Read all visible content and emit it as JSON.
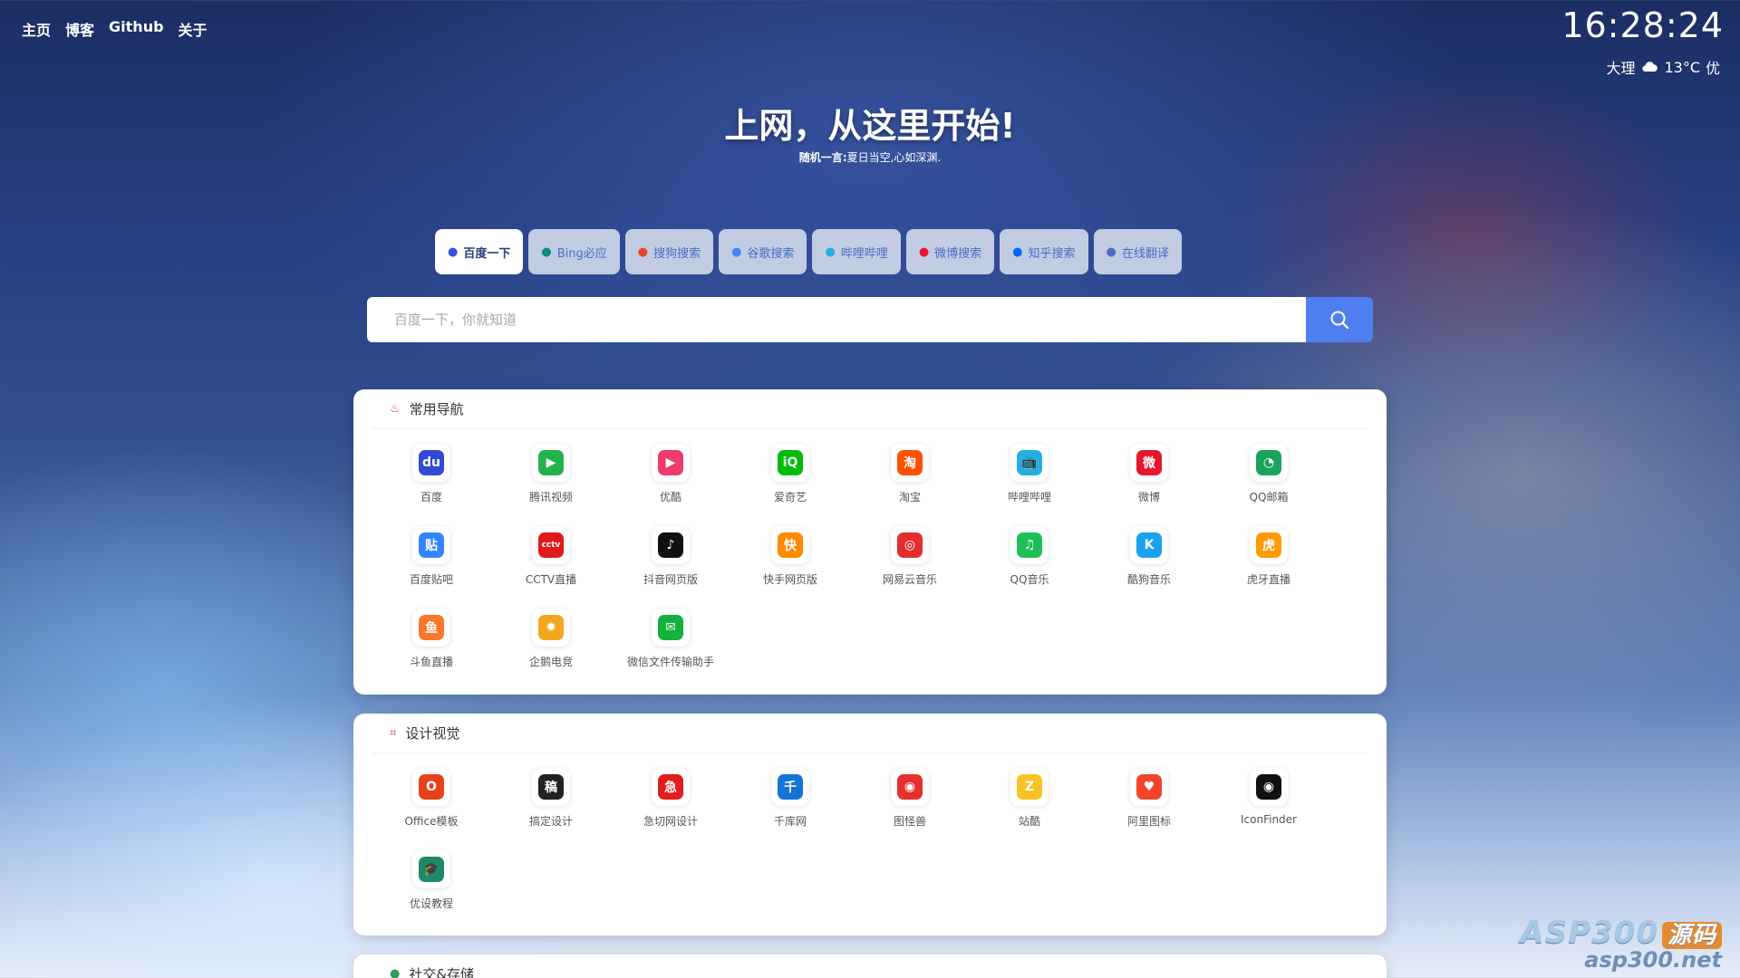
{
  "topnav": [
    "主页",
    "博客",
    "Github",
    "关于"
  ],
  "clock": "16:28:24",
  "weather": {
    "city": "大理",
    "icon": "cloud-icon",
    "temp": "13°C",
    "aqi": "优"
  },
  "hero": {
    "title": "上网，从这里开始!",
    "quote_prefix": "随机一言:",
    "quote": "夏日当空,心如深渊."
  },
  "engines": [
    {
      "label": "百度一下",
      "icon": "baidu-icon",
      "color": "#3452d6",
      "active": true
    },
    {
      "label": "Bing必应",
      "icon": "bing-icon",
      "color": "#0c8a7a",
      "active": false
    },
    {
      "label": "搜狗搜索",
      "icon": "sogou-icon",
      "color": "#e2452f",
      "active": false
    },
    {
      "label": "谷歌搜索",
      "icon": "google-icon",
      "color": "#4285f4",
      "active": false
    },
    {
      "label": "哔哩哔哩",
      "icon": "bilibili-icon",
      "color": "#23ade5",
      "active": false
    },
    {
      "label": "微博搜索",
      "icon": "weibo-icon",
      "color": "#e6162d",
      "active": false
    },
    {
      "label": "知乎搜索",
      "icon": "zhihu-icon",
      "color": "#0066ff",
      "active": false
    },
    {
      "label": "在线翻译",
      "icon": "translate-icon",
      "color": "#4a6cc8",
      "active": false
    }
  ],
  "search": {
    "placeholder": "百度一下，你就知道"
  },
  "sections": [
    {
      "title": "常用导航",
      "icon": "fire-icon",
      "icon_color": "#e23d3d",
      "items": [
        {
          "label": "百度",
          "glyph": "du",
          "color": "#2f4bd6",
          "icon": "baidu-icon"
        },
        {
          "label": "腾讯视频",
          "glyph": "▶",
          "color": "#22b24c",
          "icon": "tencent-video-icon"
        },
        {
          "label": "优酷",
          "glyph": "▶",
          "color": "#ef3b6a",
          "icon": "youku-icon"
        },
        {
          "label": "爱奇艺",
          "glyph": "iQ",
          "color": "#00be06",
          "icon": "iqiyi-icon"
        },
        {
          "label": "淘宝",
          "glyph": "淘",
          "color": "#ff5000",
          "icon": "taobao-icon"
        },
        {
          "label": "哔哩哔哩",
          "glyph": "📺",
          "color": "#23ade5",
          "icon": "bilibili-icon"
        },
        {
          "label": "微博",
          "glyph": "微",
          "color": "#e6162d",
          "icon": "weibo-icon"
        },
        {
          "label": "QQ邮箱",
          "glyph": "◔",
          "color": "#1aa35b",
          "icon": "qq-mail-icon"
        },
        {
          "label": "百度贴吧",
          "glyph": "贴",
          "color": "#3385ff",
          "icon": "tieba-icon"
        },
        {
          "label": "CCTV直播",
          "glyph": "cctv",
          "color": "#e01a1a",
          "icon": "cctv-icon"
        },
        {
          "label": "抖音网页版",
          "glyph": "♪",
          "color": "#111111",
          "icon": "douyin-icon"
        },
        {
          "label": "快手网页版",
          "glyph": "快",
          "color": "#ff8a00",
          "icon": "kuaishou-icon"
        },
        {
          "label": "网易云音乐",
          "glyph": "◎",
          "color": "#e12f2f",
          "icon": "netease-music-icon"
        },
        {
          "label": "QQ音乐",
          "glyph": "♫",
          "color": "#1fbf57",
          "icon": "qq-music-icon"
        },
        {
          "label": "酷狗音乐",
          "glyph": "K",
          "color": "#1aa2ed",
          "icon": "kugou-icon"
        },
        {
          "label": "虎牙直播",
          "glyph": "虎",
          "color": "#ff9a00",
          "icon": "huya-icon"
        },
        {
          "label": "斗鱼直播",
          "glyph": "鱼",
          "color": "#f8772c",
          "icon": "douyu-icon"
        },
        {
          "label": "企鹅电竞",
          "glyph": "✹",
          "color": "#f3a81c",
          "icon": "penguin-esports-icon"
        },
        {
          "label": "微信文件传输助手",
          "glyph": "✉",
          "color": "#15b13d",
          "icon": "wechat-icon"
        }
      ]
    },
    {
      "title": "设计视觉",
      "icon": "crop-icon",
      "icon_color": "#d63a8c",
      "items": [
        {
          "label": "Office模板",
          "glyph": "O",
          "color": "#e6421a",
          "icon": "office-icon"
        },
        {
          "label": "搞定设计",
          "glyph": "稿",
          "color": "#222222",
          "icon": "gaoding-icon"
        },
        {
          "label": "急切网设计",
          "glyph": "急",
          "color": "#e11d1d",
          "icon": "jiqie-icon"
        },
        {
          "label": "千库网",
          "glyph": "千",
          "color": "#1474d6",
          "icon": "qianku-icon"
        },
        {
          "label": "图怪兽",
          "glyph": "◉",
          "color": "#e5312d",
          "icon": "818ps-icon"
        },
        {
          "label": "站酷",
          "glyph": "Z",
          "color": "#f7c325",
          "icon": "zcool-icon"
        },
        {
          "label": "阿里图标",
          "glyph": "♥",
          "color": "#f0452c",
          "icon": "iconfont-icon"
        },
        {
          "label": "IconFinder",
          "glyph": "◉",
          "color": "#111111",
          "icon": "eye-icon"
        },
        {
          "label": "优设教程",
          "glyph": "🎓",
          "color": "#1c8a6b",
          "icon": "graduation-cap-icon"
        }
      ]
    },
    {
      "title": "社交&存储",
      "icon": "chat-icon",
      "icon_color": "#2e9b5a",
      "items": []
    }
  ],
  "watermark": {
    "brand": "ASP300",
    "tag": "源码",
    "url": "asp300.net"
  }
}
